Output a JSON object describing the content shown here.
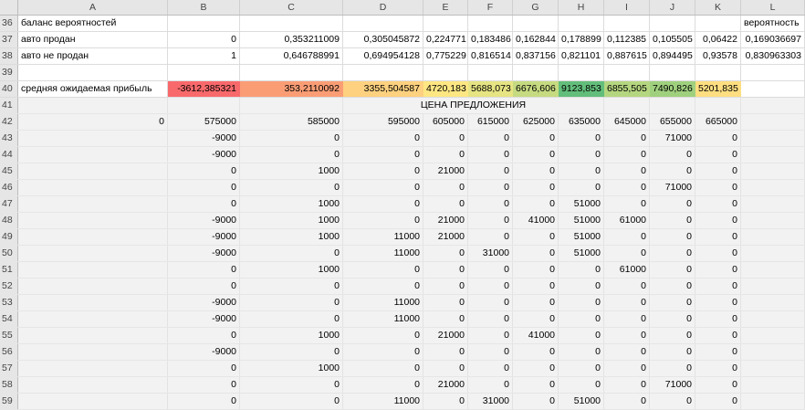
{
  "columns": [
    "A",
    "B",
    "C",
    "D",
    "E",
    "F",
    "G",
    "H",
    "I",
    "J",
    "K",
    "L"
  ],
  "rows": [
    {
      "n": "36",
      "cells": [
        "баланс вероятностей",
        "",
        "",
        "",
        "",
        "",
        "",
        "",
        "",
        "",
        "",
        "вероятность"
      ]
    },
    {
      "n": "37",
      "cells": [
        "авто продан",
        "0",
        "0,353211009",
        "0,305045872",
        "0,224771",
        "0,183486",
        "0,162844",
        "0,178899",
        "0,112385",
        "0,105505",
        "0,06422",
        "0,169036697"
      ]
    },
    {
      "n": "38",
      "cells": [
        "авто не продан",
        "1",
        "0,646788991",
        "0,694954128",
        "0,775229",
        "0,816514",
        "0,837156",
        "0,821101",
        "0,887615",
        "0,894495",
        "0,93578",
        "0,830963303"
      ]
    },
    {
      "n": "39",
      "cells": [
        "",
        "",
        "",
        "",
        "",
        "",
        "",
        "",
        "",
        "",
        "",
        ""
      ]
    },
    {
      "n": "40",
      "cells": [
        "средняя ожидаемая прибыль",
        "-3612,385321",
        "353,2110092",
        "3355,504587",
        "4720,183",
        "5688,073",
        "6676,606",
        "9123,853",
        "6855,505",
        "7490,826",
        "5201,835",
        ""
      ]
    },
    {
      "n": "41",
      "cells": [
        "",
        "",
        "",
        "ЦЕНА ПРЕДЛОЖЕНИЯ",
        "",
        "",
        "",
        "",
        "",
        "",
        "",
        ""
      ]
    },
    {
      "n": "42",
      "cells": [
        "0",
        "575000",
        "585000",
        "595000",
        "605000",
        "615000",
        "625000",
        "635000",
        "645000",
        "655000",
        "665000",
        ""
      ]
    },
    {
      "n": "43",
      "cells": [
        "",
        "-9000",
        "0",
        "0",
        "0",
        "0",
        "0",
        "0",
        "0",
        "71000",
        "0",
        ""
      ]
    },
    {
      "n": "44",
      "cells": [
        "",
        "-9000",
        "0",
        "0",
        "0",
        "0",
        "0",
        "0",
        "0",
        "0",
        "0",
        ""
      ]
    },
    {
      "n": "45",
      "cells": [
        "",
        "0",
        "1000",
        "0",
        "21000",
        "0",
        "0",
        "0",
        "0",
        "0",
        "0",
        ""
      ]
    },
    {
      "n": "46",
      "cells": [
        "",
        "0",
        "0",
        "0",
        "0",
        "0",
        "0",
        "0",
        "0",
        "71000",
        "0",
        ""
      ]
    },
    {
      "n": "47",
      "cells": [
        "",
        "0",
        "1000",
        "0",
        "0",
        "0",
        "0",
        "51000",
        "0",
        "0",
        "0",
        ""
      ]
    },
    {
      "n": "48",
      "cells": [
        "",
        "-9000",
        "1000",
        "0",
        "21000",
        "0",
        "41000",
        "51000",
        "61000",
        "0",
        "0",
        ""
      ]
    },
    {
      "n": "49",
      "cells": [
        "",
        "-9000",
        "1000",
        "11000",
        "21000",
        "0",
        "0",
        "51000",
        "0",
        "0",
        "0",
        ""
      ]
    },
    {
      "n": "50",
      "cells": [
        "",
        "-9000",
        "0",
        "11000",
        "0",
        "31000",
        "0",
        "51000",
        "0",
        "0",
        "0",
        ""
      ]
    },
    {
      "n": "51",
      "cells": [
        "",
        "0",
        "1000",
        "0",
        "0",
        "0",
        "0",
        "0",
        "61000",
        "0",
        "0",
        ""
      ]
    },
    {
      "n": "52",
      "cells": [
        "",
        "0",
        "0",
        "0",
        "0",
        "0",
        "0",
        "0",
        "0",
        "0",
        "0",
        ""
      ]
    },
    {
      "n": "53",
      "cells": [
        "",
        "-9000",
        "0",
        "11000",
        "0",
        "0",
        "0",
        "0",
        "0",
        "0",
        "0",
        ""
      ]
    },
    {
      "n": "54",
      "cells": [
        "",
        "-9000",
        "0",
        "11000",
        "0",
        "0",
        "0",
        "0",
        "0",
        "0",
        "0",
        ""
      ]
    },
    {
      "n": "55",
      "cells": [
        "",
        "0",
        "1000",
        "0",
        "21000",
        "0",
        "41000",
        "0",
        "0",
        "0",
        "0",
        ""
      ]
    },
    {
      "n": "56",
      "cells": [
        "",
        "-9000",
        "0",
        "0",
        "0",
        "0",
        "0",
        "0",
        "0",
        "0",
        "0",
        ""
      ]
    },
    {
      "n": "57",
      "cells": [
        "",
        "0",
        "1000",
        "0",
        "0",
        "0",
        "0",
        "0",
        "0",
        "0",
        "0",
        ""
      ]
    },
    {
      "n": "58",
      "cells": [
        "",
        "0",
        "0",
        "0",
        "21000",
        "0",
        "0",
        "0",
        "0",
        "71000",
        "0",
        ""
      ]
    },
    {
      "n": "59",
      "cells": [
        "",
        "0",
        "0",
        "11000",
        "0",
        "31000",
        "0",
        "51000",
        "0",
        "0",
        "0",
        ""
      ]
    }
  ],
  "heatmap_colors": {
    "B": "#f8696b",
    "C": "#fa9d75",
    "D": "#fdd17f",
    "E": "#fee783",
    "F": "#e6e483",
    "G": "#c6db81",
    "H": "#63be7b",
    "I": "#b5d680",
    "J": "#9fd07e",
    "K": "#fede81"
  }
}
